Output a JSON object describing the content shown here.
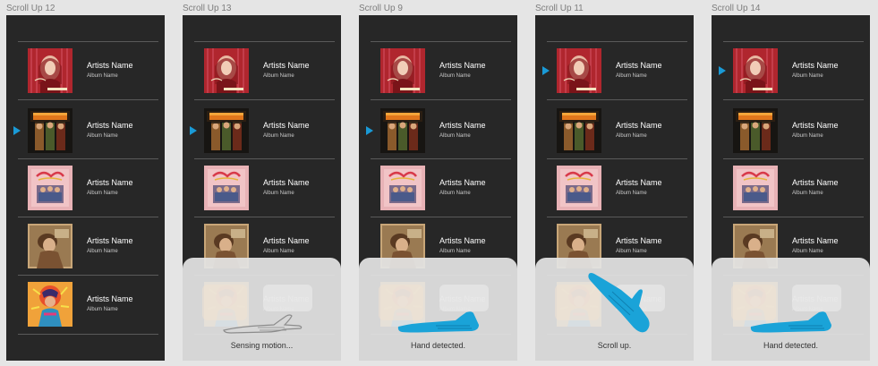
{
  "boards": [
    {
      "title": "Scroll Up 12",
      "playing_row": 1,
      "overlay": null
    },
    {
      "title": "Scroll Up 13",
      "playing_row": 1,
      "overlay": {
        "status": "Sensing motion...",
        "hand": "hand-outline-icon"
      }
    },
    {
      "title": "Scroll Up 9",
      "playing_row": 1,
      "overlay": {
        "status": "Hand detected.",
        "hand": "hand-flat-icon"
      }
    },
    {
      "title": "Scroll Up 11",
      "playing_row": 0,
      "overlay": {
        "status": "Scroll up.",
        "hand": "hand-raised-icon"
      }
    },
    {
      "title": "Scroll Up 14",
      "playing_row": 0,
      "overlay": {
        "status": "Hand detected.",
        "hand": "hand-flat-icon"
      }
    }
  ],
  "tracks": [
    {
      "artist": "Artists Name",
      "album": "Album Name",
      "art": "album-art-red"
    },
    {
      "artist": "Artists Name",
      "album": "Album Name",
      "art": "album-art-midland"
    },
    {
      "artist": "Artists Name",
      "album": "Album Name",
      "art": "album-art-pink"
    },
    {
      "artist": "Artists Name",
      "album": "Album Name",
      "art": "album-art-brown"
    },
    {
      "artist": "Artists Name",
      "album": "Album Name",
      "art": "album-art-colorful"
    }
  ],
  "colors": {
    "accent": "#1a9ad6",
    "screen": "#272727",
    "page": "#e5e5e5"
  }
}
